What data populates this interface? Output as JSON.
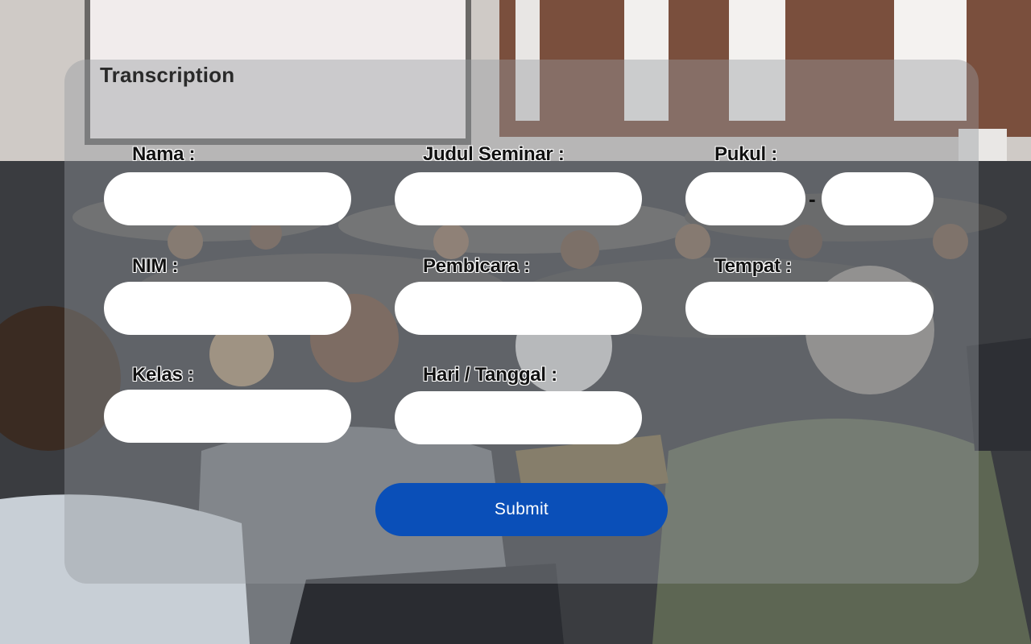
{
  "form": {
    "title": "Transcription",
    "fields": {
      "nama": {
        "label": "Nama :",
        "value": "",
        "placeholder": ""
      },
      "nim": {
        "label": "NIM :",
        "value": "",
        "placeholder": ""
      },
      "kelas": {
        "label": "Kelas :",
        "value": "",
        "placeholder": ""
      },
      "judul_seminar": {
        "label": "Judul Seminar :",
        "value": "",
        "placeholder": ""
      },
      "pembicara": {
        "label": "Pembicara :",
        "value": "",
        "placeholder": ""
      },
      "hari_tanggal": {
        "label": "Hari / Tanggal :",
        "value": "",
        "placeholder": ""
      },
      "pukul": {
        "label": "Pukul :",
        "separator": "-",
        "start_value": "",
        "end_value": ""
      },
      "tempat": {
        "label": "Tempat :",
        "value": "",
        "placeholder": ""
      }
    },
    "submit_label": "Submit"
  },
  "colors": {
    "submit_button": "#0a4fb8",
    "panel_overlay": "rgba(150,155,160,0.42)",
    "input_background": "#ffffff"
  }
}
